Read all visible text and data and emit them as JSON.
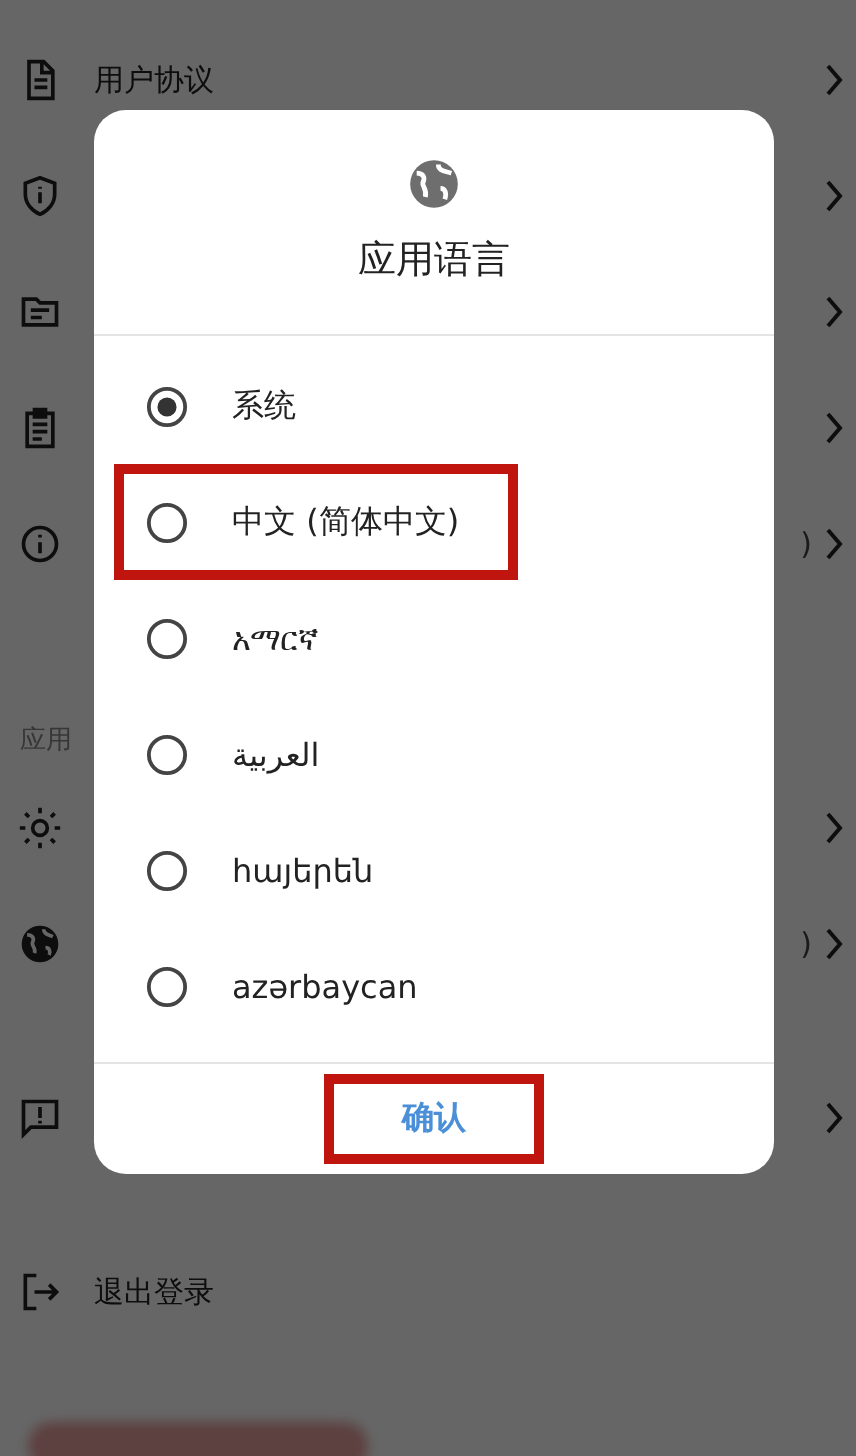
{
  "settings": {
    "groups": [
      {
        "items": [
          {
            "kind": "document",
            "label": "用户协议"
          },
          {
            "kind": "shield"
          },
          {
            "kind": "folder"
          },
          {
            "kind": "clipboard"
          },
          {
            "kind": "info",
            "value": ")"
          }
        ]
      },
      {
        "header": "应用",
        "items": [
          {
            "kind": "sun"
          },
          {
            "kind": "globe",
            "value": ")"
          }
        ]
      },
      {
        "items": [
          {
            "kind": "feedback"
          }
        ]
      },
      {
        "items": [
          {
            "kind": "logout",
            "label": "退出登录",
            "chevron": false
          }
        ]
      }
    ]
  },
  "dialog": {
    "title": "应用语言",
    "options": [
      {
        "label": "系统",
        "selected": true,
        "highlighted": false
      },
      {
        "label": "中文 (简体中文)",
        "selected": false,
        "highlighted": true
      },
      {
        "label": "አማርኛ",
        "selected": false,
        "highlighted": false
      },
      {
        "label": "العربية",
        "selected": false,
        "highlighted": false
      },
      {
        "label": "հայերեն",
        "selected": false,
        "highlighted": false
      },
      {
        "label": "azərbaycan",
        "selected": false,
        "highlighted": false
      }
    ],
    "confirm": {
      "label": "确认",
      "highlighted": true
    }
  }
}
